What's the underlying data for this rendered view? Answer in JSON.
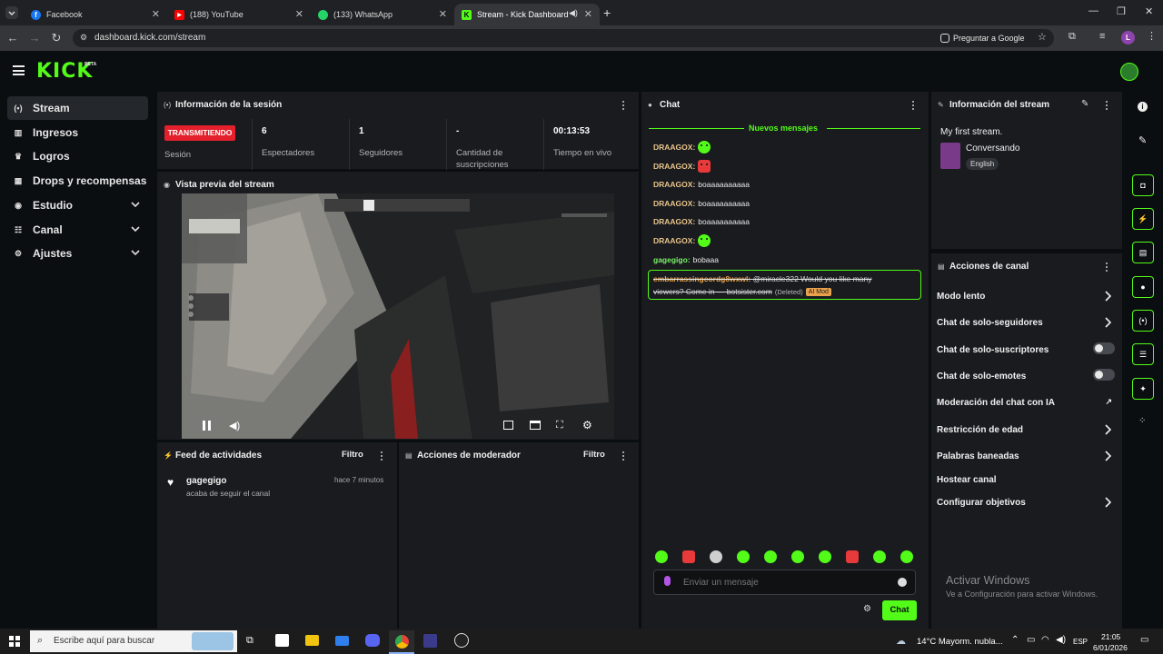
{
  "browser": {
    "tabs": [
      {
        "title": "Facebook",
        "color": "#1877f2"
      },
      {
        "title": "(188) YouTube",
        "color": "#ff0000"
      },
      {
        "title": "(133) WhatsApp",
        "color": "#25d366"
      },
      {
        "title": "Stream - Kick Dashboard",
        "color": "#53fc18"
      }
    ],
    "url": "dashboard.kick.com/stream",
    "translate_label": "Preguntar a Google",
    "profile_initial": "L"
  },
  "kick": {
    "logo": "KICK",
    "beta": "BETA",
    "accent": "#53fc18"
  },
  "nav": [
    {
      "label": "Stream",
      "icon": "broadcast-icon"
    },
    {
      "label": "Ingresos",
      "icon": "bar-chart-icon"
    },
    {
      "label": "Logros",
      "icon": "trophy-icon"
    },
    {
      "label": "Drops y recompensas",
      "icon": "gift-icon"
    },
    {
      "label": "Estudio",
      "icon": "studio-icon"
    },
    {
      "label": "Canal",
      "icon": "users-icon"
    },
    {
      "label": "Ajustes",
      "icon": "gear-icon"
    }
  ],
  "session": {
    "title": "Información de la sesión",
    "badge": "TRANSMITIENDO",
    "badge_label": "Sesión",
    "stats": [
      {
        "value": "6",
        "label": "Espectadores"
      },
      {
        "value": "1",
        "label": "Seguidores"
      },
      {
        "value": "-",
        "label": "Cantidad de suscripciones"
      },
      {
        "value": "00:13:53",
        "label": "Tiempo en vivo"
      }
    ]
  },
  "preview": {
    "title": "Vista previa del stream"
  },
  "feed": {
    "title": "Feed de actividades",
    "filter": "Filtro",
    "items": [
      {
        "user": "gagegigo",
        "time": "hace 7 minutos",
        "text": "acaba de seguir el canal"
      }
    ]
  },
  "modactions": {
    "title": "Acciones de moderador",
    "filter": "Filtro"
  },
  "chat": {
    "title": "Chat",
    "new_messages": "Nuevos mensajes",
    "messages": [
      {
        "user": "DRAAGOX:",
        "text": "",
        "emote": "green"
      },
      {
        "user": "DRAAGOX:",
        "text": "",
        "emote": "red"
      },
      {
        "user": "DRAAGOX:",
        "text": "boaaaaaaaaaa"
      },
      {
        "user": "DRAAGOX:",
        "text": "boaaaaaaaaaa"
      },
      {
        "user": "DRAAGOX:",
        "text": "boaaaaaaaaaa"
      },
      {
        "user": "DRAAGOX:",
        "text": "",
        "emote": "green"
      },
      {
        "user": "gagegigo:",
        "text": "bobaaa"
      }
    ],
    "deleted": {
      "user": "embarrassingcordg8wxwl:",
      "line1": "@miracle322 Would you like many",
      "line2": "viewers? Come in — botsister.com",
      "tag": "(Deleted)",
      "badge": "AI Mod"
    },
    "input_placeholder": "Enviar un mensaje",
    "send_label": "Chat"
  },
  "stream_info": {
    "title": "Información del stream",
    "stream_title": "My first stream.",
    "category": "Conversando",
    "language": "English"
  },
  "channel_actions": {
    "title": "Acciones de canal",
    "rows": [
      {
        "label": "Modo lento",
        "control": "chevron"
      },
      {
        "label": "Chat de solo-seguidores",
        "control": "chevron"
      },
      {
        "label": "Chat de solo-suscriptores",
        "control": "toggle",
        "enabled": false
      },
      {
        "label": "Chat de solo-emotes",
        "control": "toggle",
        "enabled": false
      },
      {
        "label": "Moderación del chat con IA",
        "control": "external"
      },
      {
        "label": "Restricción de edad",
        "control": "chevron"
      },
      {
        "label": "Palabras baneadas",
        "control": "chevron"
      },
      {
        "label": "Hostear canal",
        "control": "none"
      },
      {
        "label": "Configurar objetivos",
        "control": "chevron"
      }
    ]
  },
  "watermark": {
    "line1": "Activar Windows",
    "line2": "Ve a Configuración para activar Windows."
  },
  "taskbar": {
    "search_placeholder": "Escribe aquí para buscar",
    "weather": "14°C  Mayorm. nubla...",
    "lang": "ESP",
    "time": "21:05",
    "date": "6/01/2026"
  }
}
